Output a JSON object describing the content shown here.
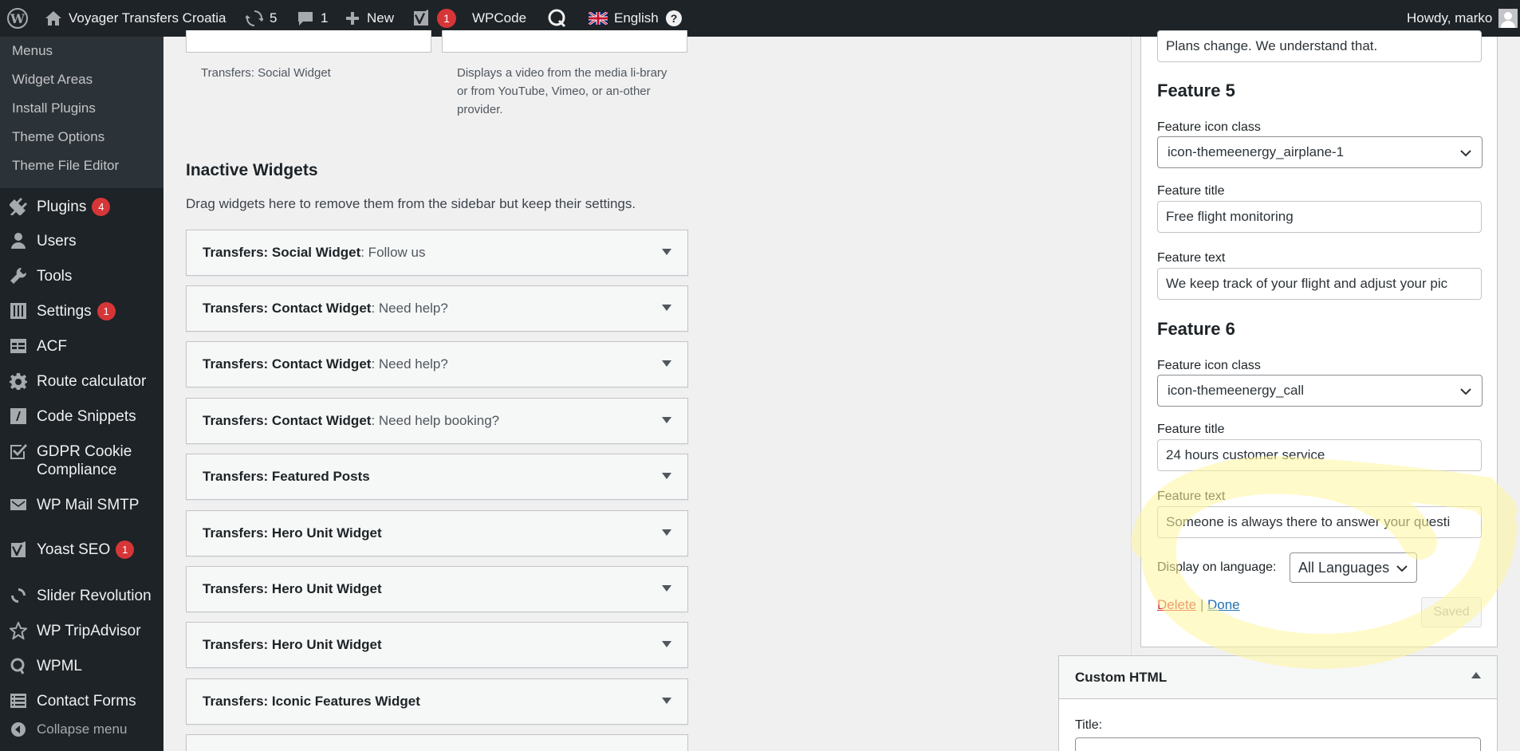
{
  "adminbar": {
    "site_name": "Voyager Transfers Croatia",
    "updates_count": "5",
    "comments_count": "1",
    "new_label": "New",
    "yoast_count": "1",
    "wpcode_label": "WPCode",
    "language_label": "English",
    "greeting": "Howdy, marko"
  },
  "sidebar": {
    "submenu": [
      "Menus",
      "Widget Areas",
      "Install Plugins",
      "Theme Options",
      "Theme File Editor"
    ],
    "items": [
      {
        "label": "Plugins",
        "badge": "4"
      },
      {
        "label": "Users"
      },
      {
        "label": "Tools"
      },
      {
        "label": "Settings",
        "badge": "1"
      },
      {
        "label": "ACF"
      },
      {
        "label": "Route calculator"
      },
      {
        "label": "Code Snippets"
      },
      {
        "label": "GDPR Cookie Compliance"
      },
      {
        "label": "WP Mail SMTP"
      },
      {
        "label": "Yoast SEO",
        "badge": "1"
      },
      {
        "label": "Slider Revolution"
      },
      {
        "label": "WP TripAdvisor"
      },
      {
        "label": "WPML"
      },
      {
        "label": "Contact Forms"
      }
    ],
    "collapse_label": "Collapse menu"
  },
  "available": {
    "social_desc": "Transfers: Social Widget",
    "video_desc": "Displays a video from the media li-brary or from YouTube, Vimeo, or an-other provider."
  },
  "inactive": {
    "title": "Inactive Widgets",
    "description": "Drag widgets here to remove them from the sidebar but keep their settings.",
    "widgets": [
      {
        "title": "Transfers: Social Widget",
        "subtitle": ": Follow us"
      },
      {
        "title": "Transfers: Contact Widget",
        "subtitle": ": Need help?"
      },
      {
        "title": "Transfers: Contact Widget",
        "subtitle": ": Need help?"
      },
      {
        "title": "Transfers: Contact Widget",
        "subtitle": ": Need help booking?"
      },
      {
        "title": "Transfers: Featured Posts",
        "subtitle": ""
      },
      {
        "title": "Transfers: Hero Unit Widget",
        "subtitle": ""
      },
      {
        "title": "Transfers: Hero Unit Widget",
        "subtitle": ""
      },
      {
        "title": "Transfers: Hero Unit Widget",
        "subtitle": ""
      },
      {
        "title": "Transfers: Iconic Features Widget",
        "subtitle": ""
      }
    ]
  },
  "panel": {
    "top_text_value": "Plans change. We understand that.",
    "feature5": {
      "heading": "Feature 5",
      "icon_label": "Feature icon class",
      "icon_value": "icon-themeenergy_airplane-1",
      "title_label": "Feature title",
      "title_value": "Free flight monitoring",
      "text_label": "Feature text",
      "text_value": "We keep track of your flight and adjust your pic"
    },
    "feature6": {
      "heading": "Feature 6",
      "icon_label": "Feature icon class",
      "icon_value": "icon-themeenergy_call",
      "title_label": "Feature title",
      "title_value": "24 hours customer service",
      "text_label": "Feature text",
      "text_value": "Someone is always there to answer your questi"
    },
    "language_label": "Display on language:",
    "language_value": "All Languages",
    "delete_label": "Delete",
    "separator": "|",
    "done_label": "Done",
    "saved_label": "Saved"
  },
  "custom_html": {
    "title": "Custom HTML",
    "title_label": "Title:"
  },
  "colors": {
    "adminbar_bg": "#1d2327",
    "badge": "#d63638",
    "link": "#2271b1",
    "highlight": "#fff59d"
  }
}
